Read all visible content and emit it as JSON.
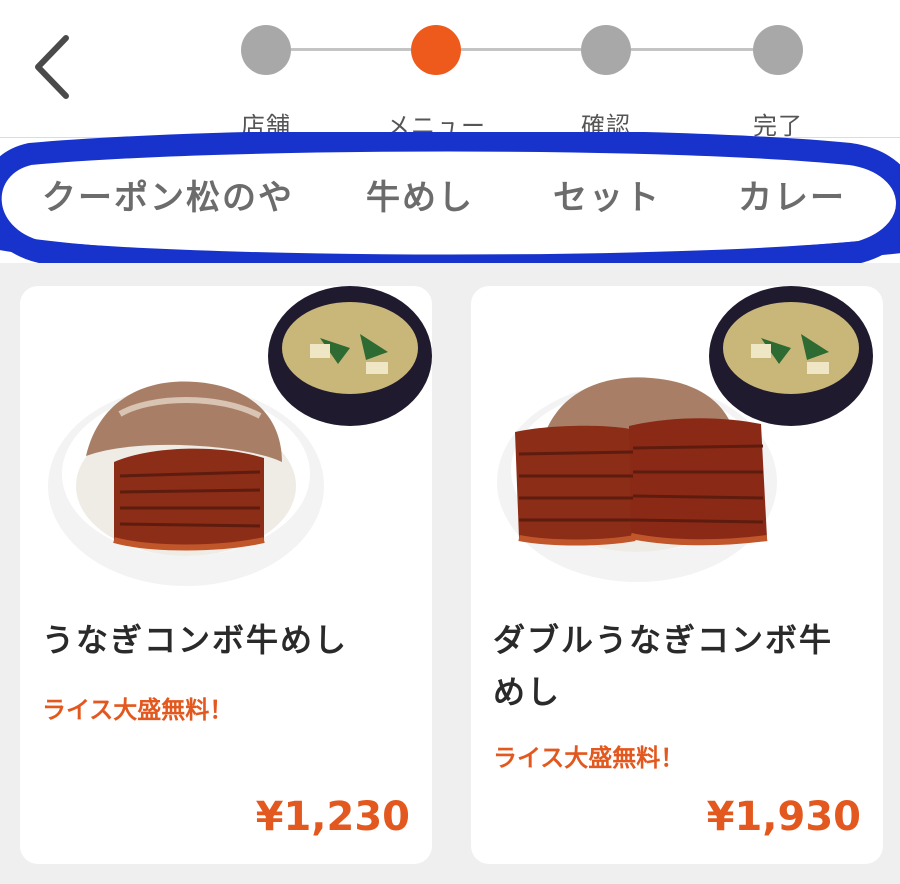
{
  "header": {
    "steps": [
      {
        "label": "店舗",
        "active": false
      },
      {
        "label": "メニュー",
        "active": true
      },
      {
        "label": "確認",
        "active": false
      },
      {
        "label": "完了",
        "active": false
      }
    ]
  },
  "categories": [
    {
      "label": "クーポン松のや"
    },
    {
      "label": "牛めし"
    },
    {
      "label": "セット"
    },
    {
      "label": "カレー"
    }
  ],
  "products": [
    {
      "name": "うなぎコンボ牛めし",
      "promo": "ライス大盛無料！",
      "price": "¥1,230",
      "image": "single-eel-gyudon-with-miso-soup"
    },
    {
      "name": "ダブルうなぎコンボ牛めし",
      "promo": "ライス大盛無料！",
      "price": "¥1,930",
      "image": "double-eel-gyudon-with-miso-soup"
    }
  ],
  "colors": {
    "accent": "#ee5a1c",
    "step_inactive": "#a8a8a8",
    "annotation": "#1733cc"
  },
  "icons": {
    "back": "chevron-left-icon"
  }
}
